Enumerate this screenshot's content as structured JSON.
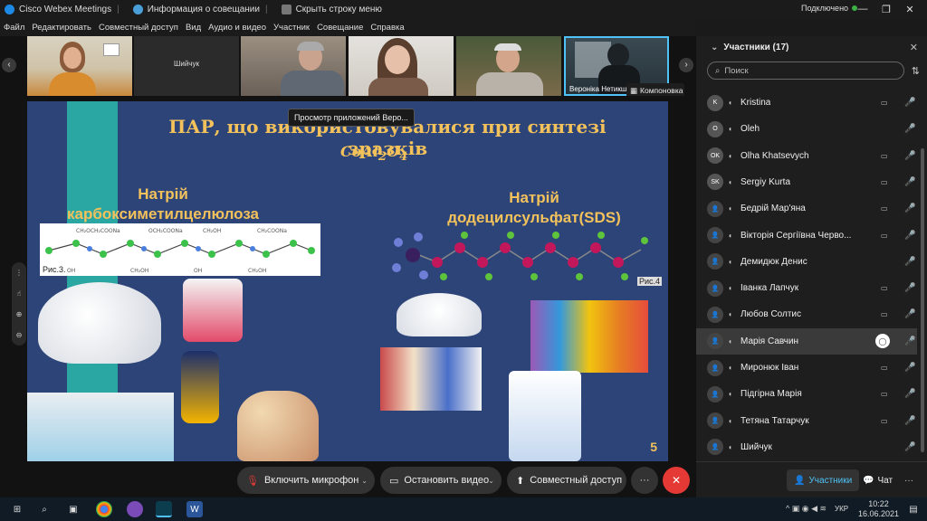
{
  "titlebar": {
    "app_title": "Cisco Webex Meetings",
    "info_label": "Информация о совещании",
    "hide_label": "Скрыть строку меню",
    "connection": "Подключено"
  },
  "menu": [
    "Файл",
    "Редактировать",
    "Совместный доступ",
    "Вид",
    "Аудио и видео",
    "Участник",
    "Совещание",
    "Справка"
  ],
  "video_strip": {
    "tiles": [
      {
        "name": ""
      },
      {
        "name": "Шийчук"
      },
      {
        "name": ""
      },
      {
        "name": ""
      },
      {
        "name": ""
      },
      {
        "name": "Вероніка Нетикша"
      }
    ],
    "layout_button": "Компоновка"
  },
  "share": {
    "tooltip": "Просмотр приложений Веро...",
    "slide": {
      "title": "ПАР, що використовувалися при синтезі зразків",
      "formula": "CoAl",
      "formula_sub1": "2",
      "formula_mid": "O",
      "formula_sub2": "4",
      "left_label_1": "Натрій",
      "left_label_2": "карбоксиметилцелюлоза",
      "right_label_1": "Натрій",
      "right_label_2": "додецилсульфат(SDS)",
      "fig3": "Рис.3.",
      "fig4": "Рис.4",
      "page": "5"
    }
  },
  "controls": {
    "mic": "Включить микрофон",
    "video": "Остановить видео",
    "share": "Совместный доступ",
    "more": "···",
    "end": "✕"
  },
  "panel": {
    "title": "Участники (17)",
    "search_placeholder": "Поиск",
    "participants": [
      {
        "initials": "K",
        "name": "Kristina",
        "video": true,
        "muted": true,
        "highlight": false
      },
      {
        "initials": "O",
        "name": "Oleh",
        "video": false,
        "muted": true,
        "highlight": false
      },
      {
        "initials": "OK",
        "name": "Olha Khatsevych",
        "video": true,
        "muted": true,
        "highlight": false
      },
      {
        "initials": "SK",
        "name": "Sergiy Kurta",
        "video": true,
        "muted": true,
        "highlight": false
      },
      {
        "initials": "",
        "name": "Бедрій Мар'яна",
        "video": true,
        "muted": true,
        "highlight": false
      },
      {
        "initials": "",
        "name": "Вікторія Сергіївна Черво...",
        "video": true,
        "muted": true,
        "highlight": false
      },
      {
        "initials": "",
        "name": "Демидюк Денис",
        "video": false,
        "muted": true,
        "highlight": false
      },
      {
        "initials": "",
        "name": "Іванка Лапчук",
        "video": true,
        "muted": true,
        "highlight": false
      },
      {
        "initials": "",
        "name": "Любов Солтис",
        "video": true,
        "muted": true,
        "highlight": false
      },
      {
        "initials": "",
        "name": "Марія Савчин",
        "video": false,
        "muted": true,
        "highlight": true
      },
      {
        "initials": "",
        "name": "Миронюк Іван",
        "video": true,
        "muted": true,
        "highlight": false
      },
      {
        "initials": "",
        "name": "Підгірна Марія",
        "video": true,
        "muted": true,
        "highlight": false
      },
      {
        "initials": "",
        "name": "Тетяна Татарчук",
        "video": true,
        "muted": true,
        "highlight": false
      },
      {
        "initials": "",
        "name": "Шийчук",
        "video": false,
        "muted": true,
        "highlight": false
      }
    ],
    "tab_participants": "Участники",
    "tab_chat": "Чат",
    "more": "···"
  },
  "taskbar": {
    "lang": "УКР",
    "time": "10:22",
    "date": "16.06.2021"
  },
  "colors": {
    "accent": "#1e88e5",
    "end_call": "#e53935",
    "slide_bg": "#2d4479",
    "slide_text": "#f3c25b"
  }
}
